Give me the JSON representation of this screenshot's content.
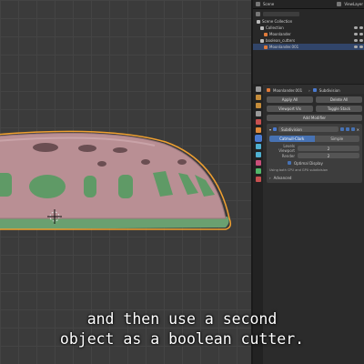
{
  "outliner": {
    "tab_label": "Scene",
    "layer_label": "ViewLayer",
    "rows": [
      {
        "label": "Scene Collection",
        "color": "#bbbbbb",
        "selected": false
      },
      {
        "label": "Collection",
        "color": "#bbbbbb",
        "selected": false
      },
      {
        "label": "Moonlander",
        "color": "#e07a3a",
        "selected": false
      },
      {
        "label": "boolean_cutters",
        "color": "#bbbbbb",
        "selected": false
      },
      {
        "label": "Moonlander.001",
        "color": "#e07a3a",
        "selected": true
      }
    ]
  },
  "properties": {
    "object_name": "Moonlander.001",
    "modifier_panel": "Subdivision",
    "apply_all": "Apply All",
    "delete_all": "Delete All",
    "viewport_vis": "Viewport Vis",
    "toggle_stack": "Toggle Stack",
    "add_modifier": "Add Modifier",
    "modifier_name": "Subdivision",
    "mode_catmull": "Catmull-Clark",
    "mode_simple": "Simple",
    "levels_viewport_label": "Levels Viewport",
    "levels_viewport_value": "2",
    "render_label": "Render",
    "render_value": "2",
    "optimal_display": "Optimal Display",
    "gpu_note": "Using both CPU and GPU subdivision",
    "advanced": "Advanced"
  },
  "subtitle": {
    "line1": "and then use a second",
    "line2": "object as a boolean cutter."
  },
  "colors": {
    "accent": "#4772b3",
    "selection_outline": "#f0a030",
    "object_pink": "#b98f94",
    "object_green": "#6aa070"
  }
}
